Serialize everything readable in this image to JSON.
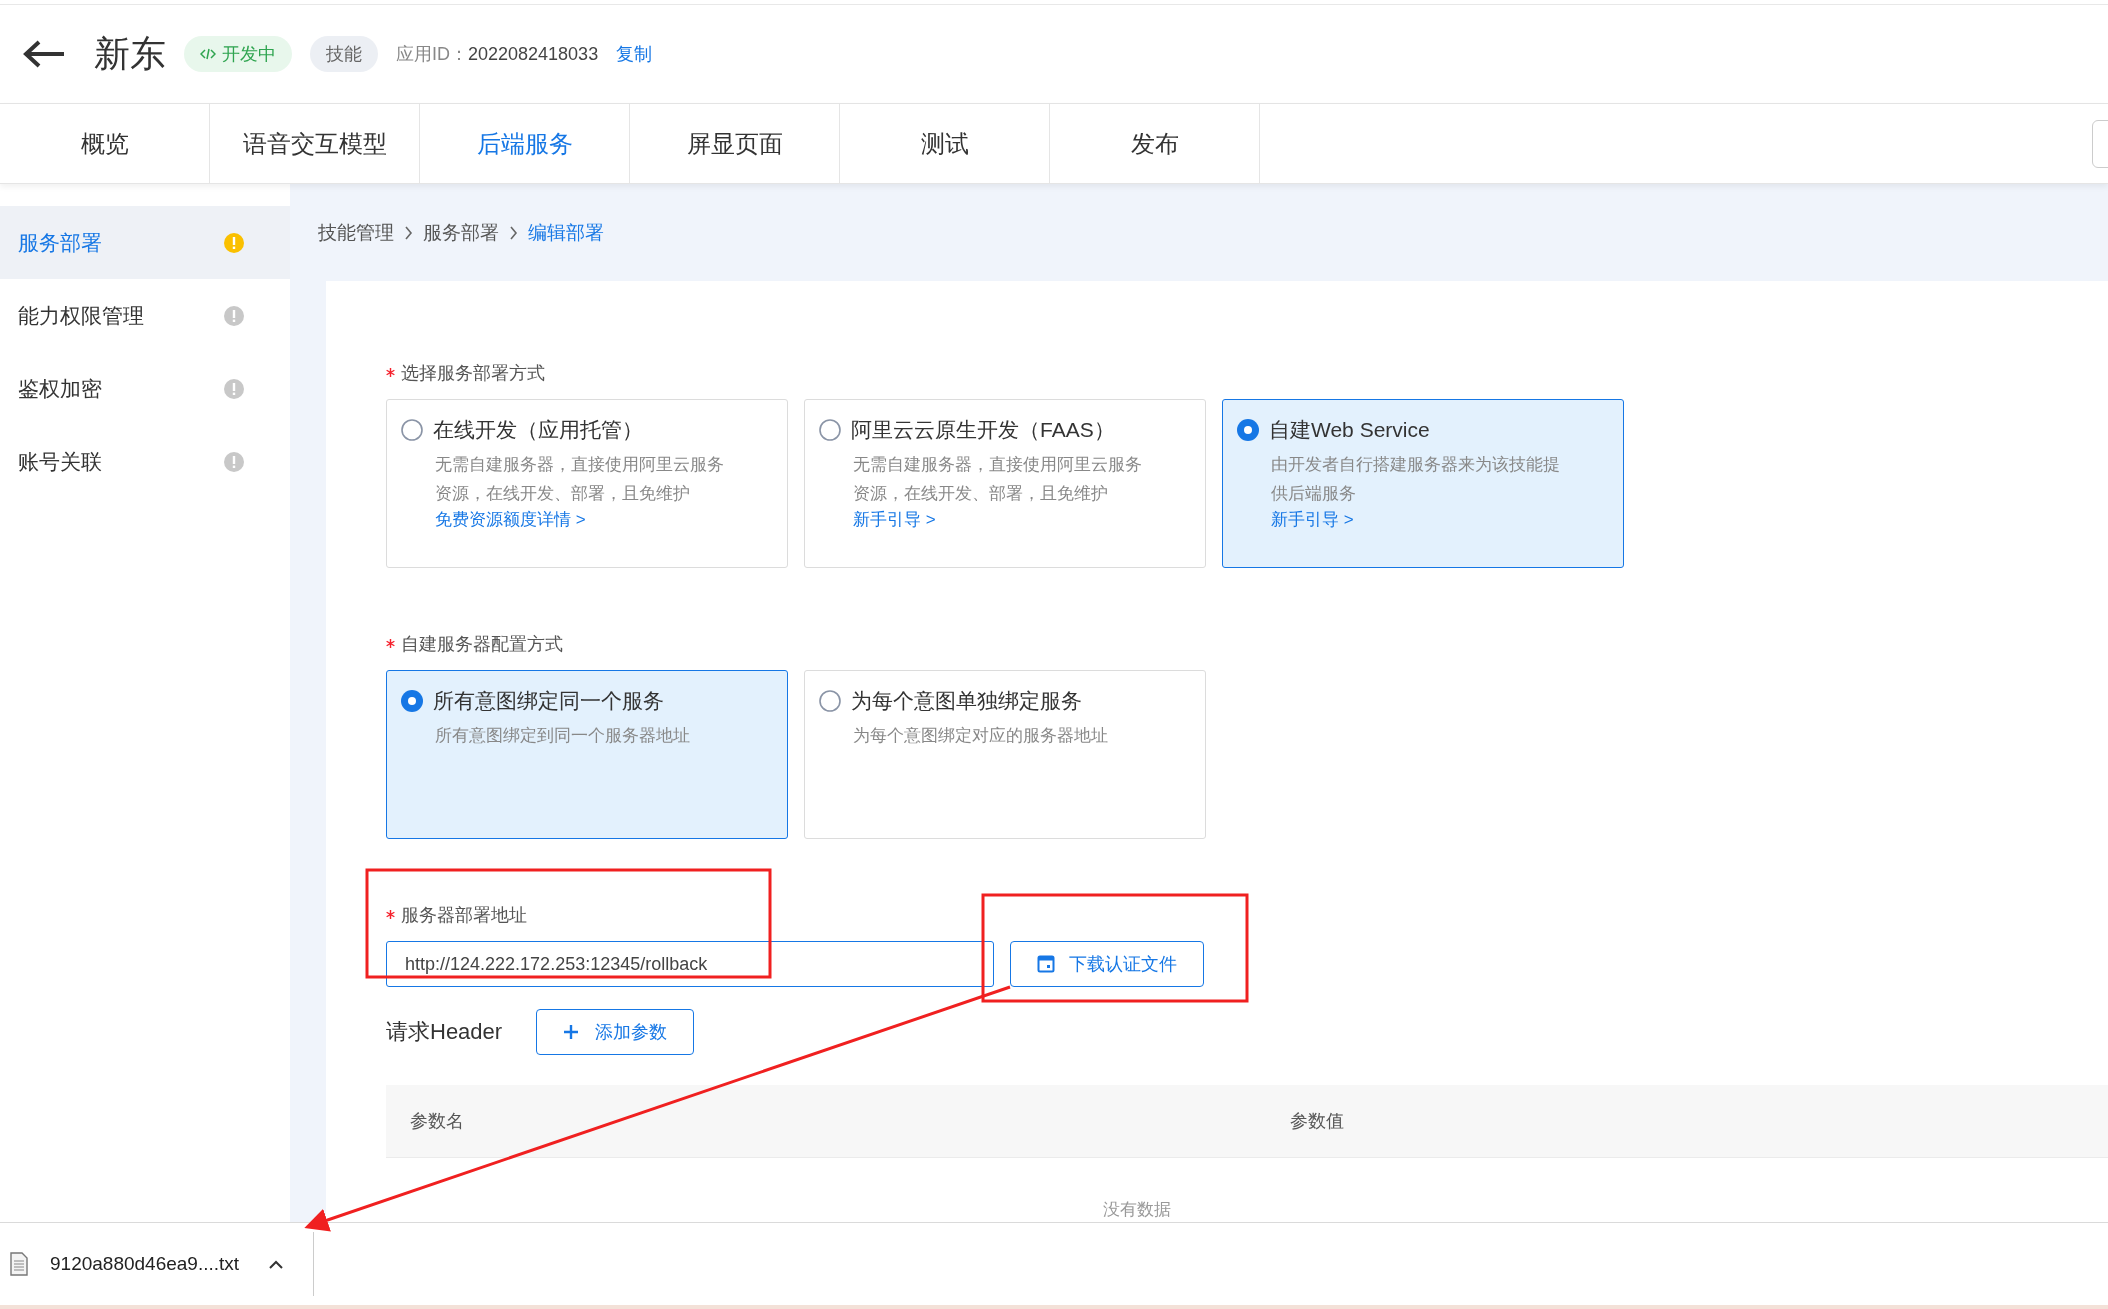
{
  "header": {
    "title": "新东",
    "status_badge": "开发中",
    "type_badge": "技能",
    "app_id_label": "应用ID：",
    "app_id": "2022082418033",
    "copy_link": "复制"
  },
  "tabs": [
    {
      "label": "概览",
      "selected": false
    },
    {
      "label": "语音交互模型",
      "selected": false
    },
    {
      "label": "后端服务",
      "selected": true
    },
    {
      "label": "屏显页面",
      "selected": false
    },
    {
      "label": "测试",
      "selected": false
    },
    {
      "label": "发布",
      "selected": false
    }
  ],
  "sidebar": {
    "items": [
      {
        "label": "服务部署",
        "selected": true,
        "color": "#fac000"
      },
      {
        "label": "能力权限管理",
        "selected": false,
        "color": "#c8c8c8"
      },
      {
        "label": "鉴权加密",
        "selected": false,
        "color": "#c8c8c8"
      },
      {
        "label": "账号关联",
        "selected": false,
        "color": "#c8c8c8"
      }
    ]
  },
  "breadcrumb": [
    {
      "label": "技能管理",
      "current": false
    },
    {
      "label": "服务部署",
      "current": false
    },
    {
      "label": "编辑部署",
      "current": true
    }
  ],
  "deploy_method": {
    "label": "选择服务部署方式",
    "required": true,
    "options": [
      {
        "title": "在线开发（应用托管）",
        "description": "无需自建服务器，直接使用阿里云服务资源，在线开发、部署，且免维护",
        "link": "免费资源额度详情 >",
        "selected": false
      },
      {
        "title": "阿里云云原生开发（FAAS）",
        "description": "无需自建服务器，直接使用阿里云服务资源，在线开发、部署，且免维护",
        "link": "新手引导 >",
        "selected": false
      },
      {
        "title": "自建Web Service",
        "description": "由开发者自行搭建服务器来为该技能提供后端服务",
        "link": "新手引导 >",
        "selected": true
      }
    ]
  },
  "config_method": {
    "label": "自建服务器配置方式",
    "required": true,
    "options": [
      {
        "title": "所有意图绑定同一个服务",
        "description": "所有意图绑定到同一个服务器地址",
        "selected": true
      },
      {
        "title": "为每个意图单独绑定服务",
        "description": "为每个意图绑定对应的服务器地址",
        "selected": false
      }
    ]
  },
  "server_address": {
    "label": "服务器部署地址",
    "required": true,
    "value": "http://124.222.172.253:12345/rollback",
    "download_button": "下载认证文件"
  },
  "header_params": {
    "label": "请求Header",
    "add_button": "添加参数",
    "columns": [
      "参数名",
      "参数值"
    ],
    "empty_text": "没有数据"
  },
  "download_bar": {
    "file_name": "9120a880d46ea9....txt"
  }
}
